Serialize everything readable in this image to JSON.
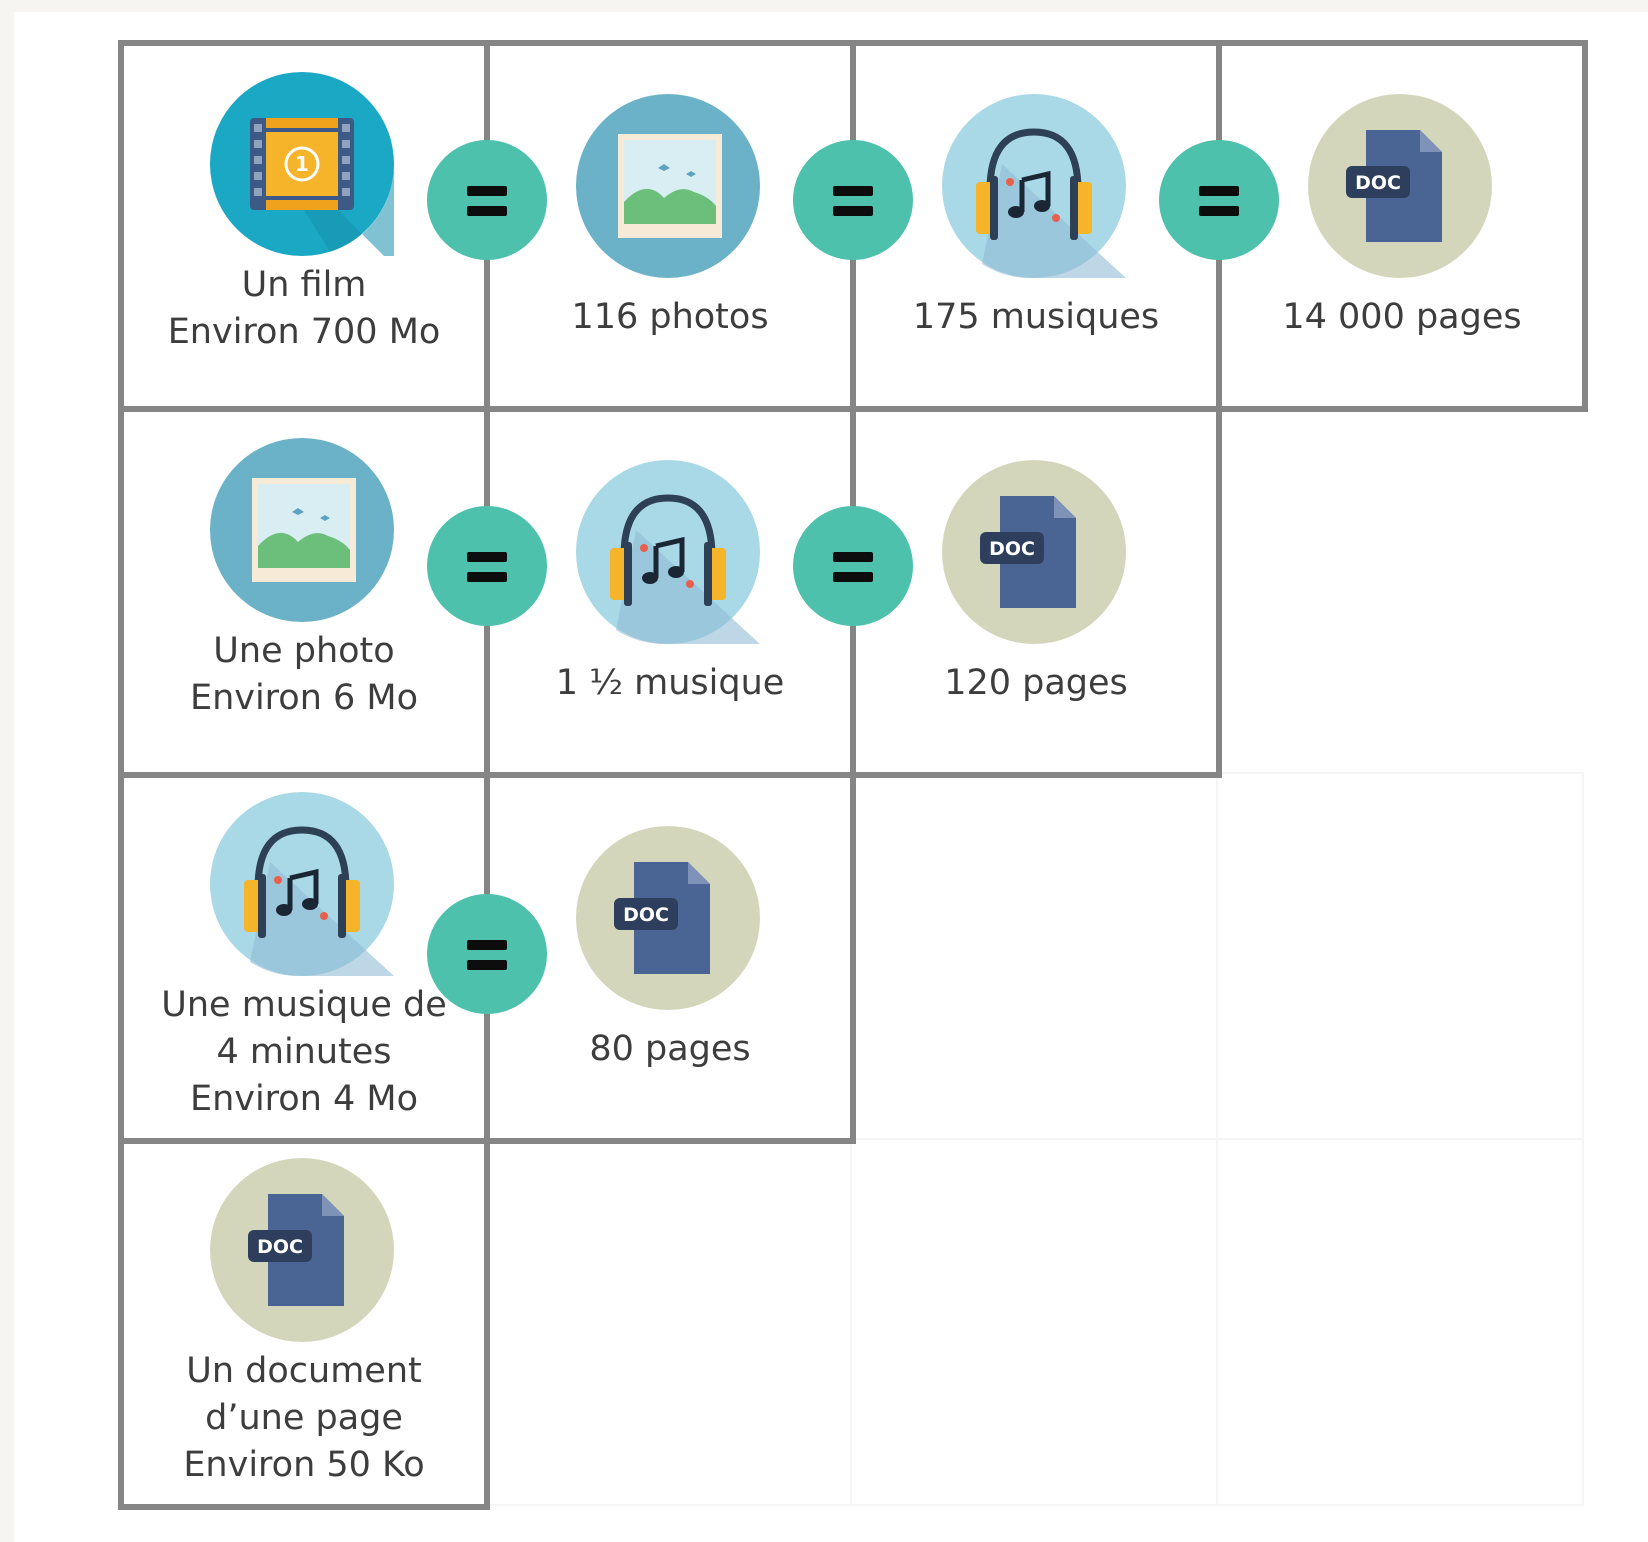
{
  "colors": {
    "border": "#858585",
    "equals_circle": "#4dc1ab",
    "film_circle": "#1aa8c4",
    "photo_circle": "#6bb2c8",
    "music_circle": "#a9d8e6",
    "doc_circle": "#d4d6bc",
    "doc_file": "#4a6494"
  },
  "equals_symbol": "=",
  "rows": [
    {
      "cells": [
        {
          "icon": "film-icon",
          "label": "Un film\nEnviron 700 Mo",
          "film_number": "1"
        },
        {
          "icon": "photo-icon",
          "label": "116 photos"
        },
        {
          "icon": "music-icon",
          "label": "175 musiques"
        },
        {
          "icon": "doc-icon",
          "label": "14 000 pages",
          "doc_tag": "DOC"
        }
      ]
    },
    {
      "cells": [
        {
          "icon": "photo-icon",
          "label": "Une photo\nEnviron 6 Mo"
        },
        {
          "icon": "music-icon",
          "label": "1 ½ musique"
        },
        {
          "icon": "doc-icon",
          "label": "120 pages",
          "doc_tag": "DOC"
        }
      ]
    },
    {
      "cells": [
        {
          "icon": "music-icon",
          "label": "Une musique de\n4 minutes\nEnviron 4 Mo"
        },
        {
          "icon": "doc-icon",
          "label": "80 pages",
          "doc_tag": "DOC"
        }
      ]
    },
    {
      "cells": [
        {
          "icon": "doc-icon",
          "label": "Un document\nd’une page\nEnviron 50 Ko",
          "doc_tag": "DOC"
        }
      ]
    }
  ]
}
